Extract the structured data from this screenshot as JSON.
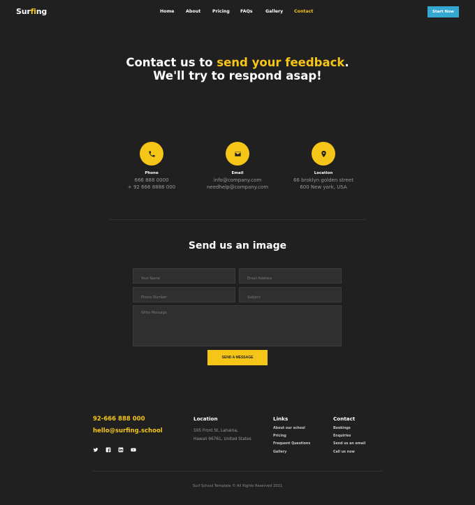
{
  "brand": {
    "name_prefix": "Sur",
    "name_mid": "fi",
    "name_suffix": "ng"
  },
  "nav": {
    "items": [
      "Home",
      "About",
      "Pricing",
      "FAQs",
      "Gallery",
      "Contact"
    ],
    "active": "Contact",
    "cta": "Start Now"
  },
  "hero": {
    "line1_pre": "Contact us to ",
    "line1_highlight": "send your feedback",
    "line1_post": ".",
    "line2": "We'll try to respond asap!"
  },
  "contact_info": [
    {
      "icon": "phone-icon",
      "title": "Phone",
      "lines": [
        "666 888 0000",
        "+ 92 666 8888 000"
      ]
    },
    {
      "icon": "email-icon",
      "title": "Email",
      "lines": [
        "info@company.com",
        "needhelp@company.com"
      ]
    },
    {
      "icon": "location-pin-icon",
      "title": "Location",
      "lines": [
        "66 broklyn golden street",
        "600 New york, USA"
      ]
    }
  ],
  "form": {
    "title": "Send us an image",
    "name_placeholder": "Your Name",
    "email_placeholder": "Email Address",
    "phone_placeholder": "Phone Number",
    "subject_placeholder": "Subject",
    "message_placeholder": "Write Message",
    "submit": "SEND A MESSAGE"
  },
  "footer": {
    "phone": "92-666 888 000",
    "email": "hello@surfing.school",
    "socials": [
      "twitter-icon",
      "facebook-icon",
      "linkedin-icon",
      "youtube-icon"
    ],
    "location": {
      "title": "Location",
      "lines": [
        "505 Front St, Lahaina,",
        "Hawaii 96761, United States"
      ]
    },
    "links": {
      "title": "Links",
      "items": [
        "About our school",
        "Pricing",
        "Frequent Questions",
        "Gallery"
      ]
    },
    "contact": {
      "title": "Contact",
      "items": [
        "Bookings",
        "Enquiries",
        "Send us an email",
        "Call us now"
      ]
    },
    "copyright": "Surf School Template  © All Rights Reserved 2021"
  },
  "colors": {
    "accent": "#f5c518",
    "background": "#202020",
    "cta": "#34a8d0"
  }
}
